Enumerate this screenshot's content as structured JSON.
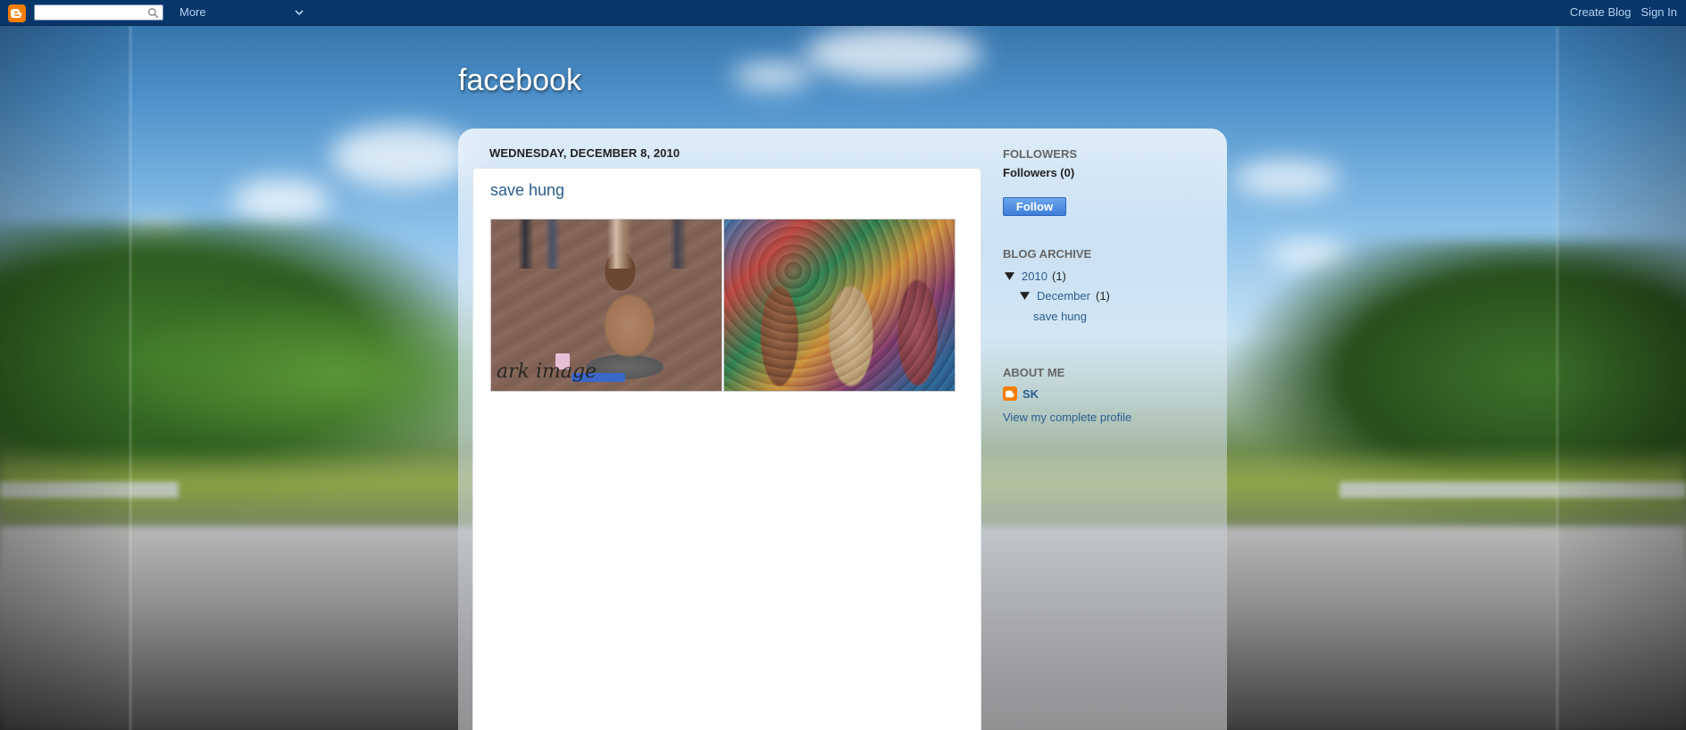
{
  "navbar": {
    "search_placeholder": "",
    "more_label": "More",
    "create_blog_label": "Create Blog",
    "sign_in_label": "Sign In"
  },
  "header": {
    "blog_title": "facebook"
  },
  "post": {
    "date": "WEDNESDAY, DECEMBER 8, 2010",
    "title": "save hung",
    "image1_watermark": "ark image"
  },
  "sidebar": {
    "followers": {
      "heading": "FOLLOWERS",
      "count_text": "Followers (0)",
      "follow_button": "Follow"
    },
    "archive": {
      "heading": "BLOG ARCHIVE",
      "year_label": "2010",
      "year_count": "(1)",
      "month_label": "December",
      "month_count": "(1)",
      "post_link": "save hung"
    },
    "about": {
      "heading": "ABOUT ME",
      "name": "SK",
      "profile_link": "View my complete profile"
    }
  },
  "colors": {
    "navbar": "#06366a",
    "link": "#2a5d8f",
    "blogger_orange": "#f57d00"
  },
  "icons": {
    "logo": "blogger-logo-icon",
    "search": "search-icon",
    "chevron": "chevron-down-icon",
    "expand": "triangle-down-icon"
  }
}
